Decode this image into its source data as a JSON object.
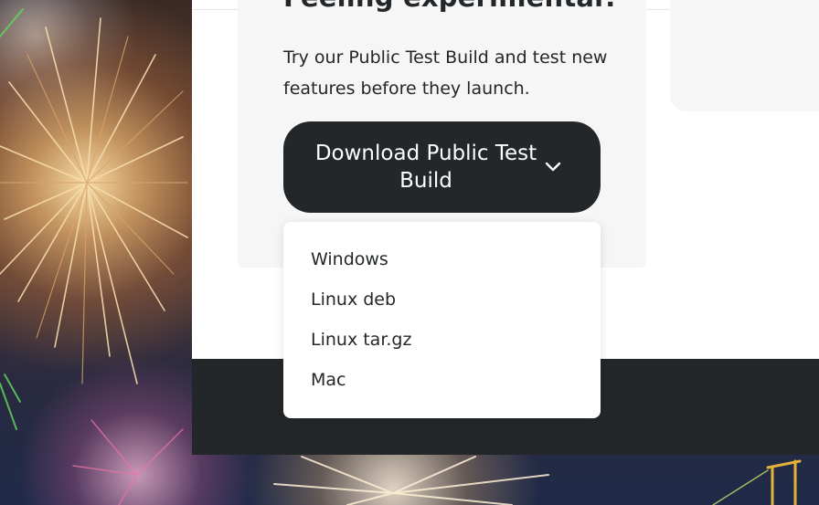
{
  "panel": {
    "heading": "Feeling experimental?",
    "description": "Try our Public Test Build and test new features before they launch."
  },
  "download_button": {
    "label": "Download Public Test Build",
    "icon": "chevron-down-icon"
  },
  "dropdown": {
    "items": [
      {
        "label": "Windows"
      },
      {
        "label": "Linux deb"
      },
      {
        "label": "Linux tar.gz"
      },
      {
        "label": "Mac"
      }
    ]
  },
  "colors": {
    "button_bg": "#23272a",
    "footer_bg": "#23272a",
    "card_bg": "#f6f6f6",
    "text": "#23272a"
  }
}
